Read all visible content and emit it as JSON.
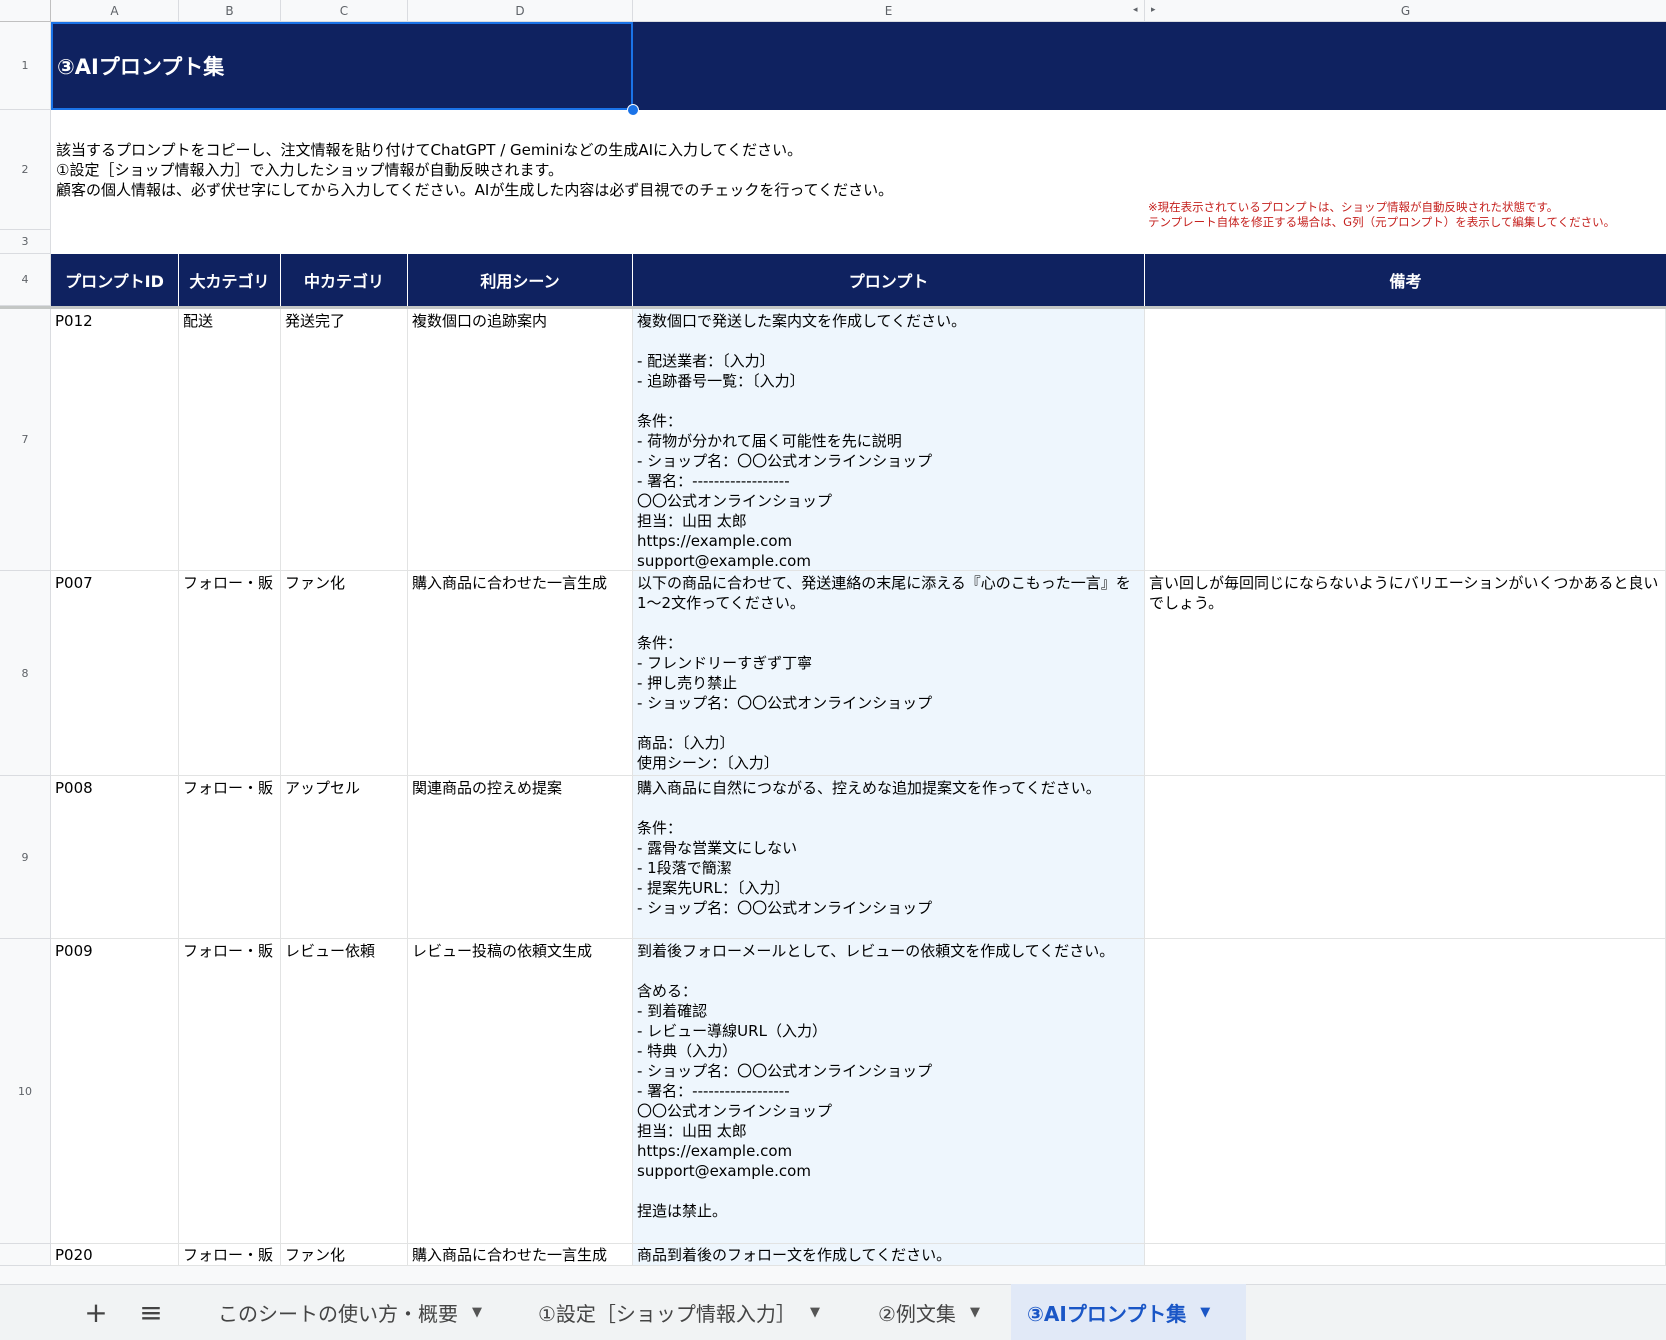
{
  "columns": [
    "A",
    "B",
    "C",
    "D",
    "E",
    "G"
  ],
  "rows": [
    "1",
    "2",
    "3",
    "4",
    "7",
    "8",
    "9",
    "10"
  ],
  "title": "③AIプロンプト集",
  "instructions": "該当するプロンプトをコピーし、注文情報を貼り付けてChatGPT / Geminiなどの生成AIに入力してください。\n①設定［ショップ情報入力］で入力したショップ情報が自動反映されます。\n顧客の個人情報は、必ず伏せ字にしてから入力してください。AIが生成した内容は必ず目視でのチェックを行ってください。",
  "note": "※現在表示されているプロンプトは、ショップ情報が自動反映された状態です。\nテンプレート自体を修正する場合は、G列（元プロンプト）を表示して編集してください。",
  "headers": [
    "プロンプトID",
    "大カテゴリ",
    "中カテゴリ",
    "利用シーン",
    "プロンプト",
    "備考"
  ],
  "data": [
    {
      "id": "P012",
      "cat": "配送",
      "sub": "発送完了",
      "scene": "複数個口の追跡案内",
      "prompt": "複数個口で発送した案内文を作成してください。\n\n- 配送業者：〔入力〕\n- 追跡番号一覧：〔入力〕\n\n条件：\n- 荷物が分かれて届く可能性を先に説明\n- ショップ名：〇〇公式オンラインショップ\n- 署名：------------------\n〇〇公式オンラインショップ\n担当：山田 太郎\nhttps://example.com\nsupport@example.com",
      "note": ""
    },
    {
      "id": "P007",
      "cat": "フォロー・販",
      "sub": "ファン化",
      "scene": "購入商品に合わせた一言生成",
      "prompt": "以下の商品に合わせて、発送連絡の末尾に添える『心のこもった一言』を1〜2文作ってください。\n\n条件：\n- フレンドリーすぎず丁寧\n- 押し売り禁止\n- ショップ名：〇〇公式オンラインショップ\n\n商品：〔入力〕\n使用シーン：〔入力〕",
      "note": "言い回しが毎回同じにならないようにバリエーションがいくつかあると良いでしょう。"
    },
    {
      "id": "P008",
      "cat": "フォロー・販",
      "sub": "アップセル",
      "scene": "関連商品の控えめ提案",
      "prompt": "購入商品に自然につながる、控えめな追加提案文を作ってください。\n\n条件：\n- 露骨な営業文にしない\n- 1段落で簡潔\n- 提案先URL：〔入力〕\n- ショップ名：〇〇公式オンラインショップ",
      "note": ""
    },
    {
      "id": "P009",
      "cat": "フォロー・販",
      "sub": "レビュー依頼",
      "scene": "レビュー投稿の依頼文生成",
      "prompt": "到着後フォローメールとして、レビューの依頼文を作成してください。\n\n含める：\n- 到着確認\n- レビュー導線URL（入力）\n- 特典（入力）\n- ショップ名：〇〇公式オンラインショップ\n- 署名：------------------\n〇〇公式オンラインショップ\n担当：山田 太郎\nhttps://example.com\nsupport@example.com\n\n捏造は禁止。",
      "note": ""
    },
    {
      "id": "P020",
      "cat": "フォロー・販",
      "sub": "ファン化",
      "scene": "購入商品に合わせた一言生成",
      "prompt": "商品到着後のフォロー文を作成してください。",
      "note": ""
    }
  ],
  "tabs": {
    "add": "+",
    "menu": "≡",
    "items": [
      "このシートの使い方・概要",
      "①設定［ショップ情報入力］",
      "②例文集",
      "③AIプロンプト集"
    ],
    "active_index": 3
  }
}
